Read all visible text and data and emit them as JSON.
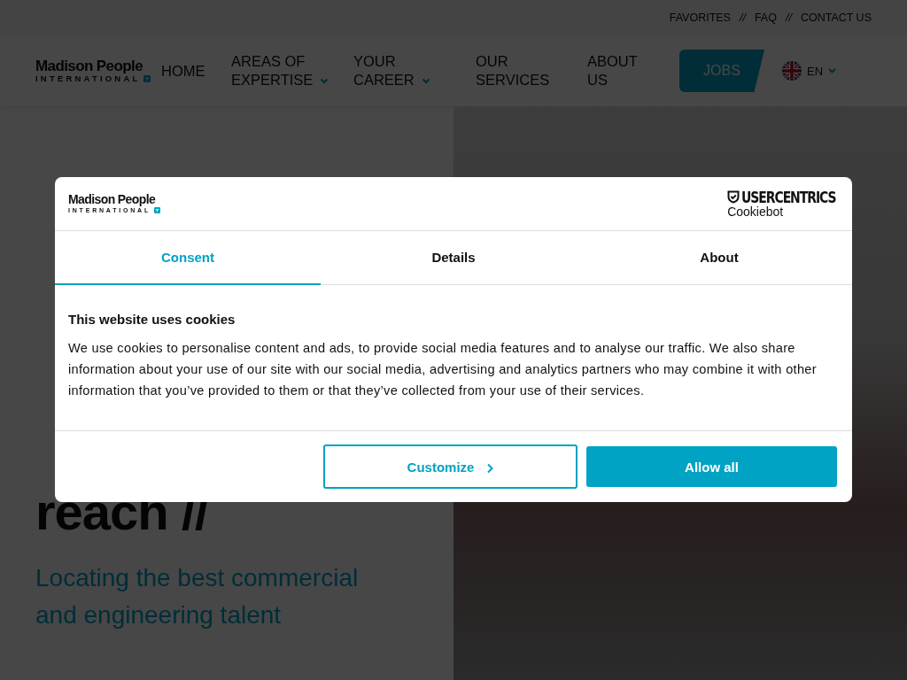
{
  "utility_links": [
    "FAVORITES",
    "FAQ",
    "CONTACT US"
  ],
  "utility_separator": "//",
  "logo": {
    "name": "Madison People",
    "subtitle": "INTERNATIONAL"
  },
  "nav": [
    {
      "label": "HOME",
      "dropdown": false
    },
    {
      "label": "AREAS OF EXPERTISE",
      "dropdown": true
    },
    {
      "label": "YOUR CAREER",
      "dropdown": true
    },
    {
      "label": "OUR SERVICES",
      "dropdown": false
    },
    {
      "label": "ABOUT US",
      "dropdown": false
    }
  ],
  "jobs_button": "JOBS",
  "language": "EN",
  "hero": {
    "headline_lines": [
      "reach //"
    ],
    "subtitle": "Locating the best commercial and engineering talent"
  },
  "cookie_dialog": {
    "logo": {
      "name": "Madison People",
      "subtitle": "INTERNATIONAL"
    },
    "provider": {
      "name": "USERCENTRICS",
      "product": "Cookiebot"
    },
    "tabs": [
      {
        "label": "Consent",
        "selected": true
      },
      {
        "label": "Details",
        "selected": false
      },
      {
        "label": "About",
        "selected": false
      }
    ],
    "heading": "This website uses cookies",
    "body": "We use cookies to personalise content and ads, to provide social media features and to analyse our traffic. We also share information about your use of our site with our social media, advertising and analytics partners who may combine it with other information that you’ve provided to them or that they’ve collected from your use of their services.",
    "buttons": [
      {
        "label": "Customize",
        "kind": "outline"
      },
      {
        "label": "Allow all",
        "kind": "filled"
      }
    ]
  }
}
